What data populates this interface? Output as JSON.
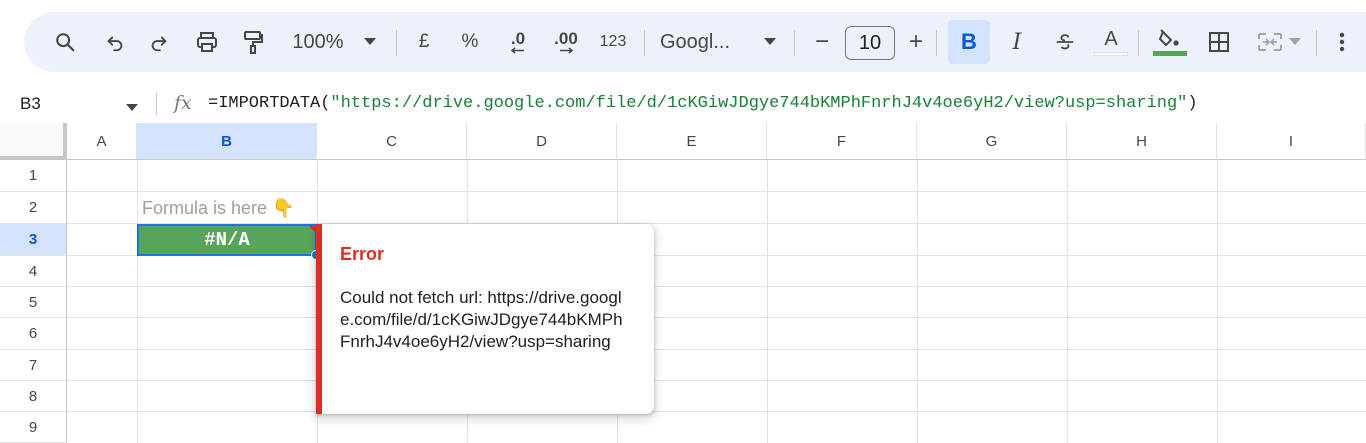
{
  "toolbar": {
    "zoom": "100%",
    "currency": "£",
    "percent": "%",
    "decrease_decimal": ".0",
    "increase_decimal": ".00",
    "number_format": "123",
    "font": "Googl...",
    "font_size": "10",
    "size_minus": "−",
    "size_plus": "+",
    "bold": "B",
    "italic": "I",
    "text_color_letter": "A",
    "colors": {
      "accent": "#d3e3fd",
      "fill_underline": "#57a55b",
      "text_underline": "#ffffff"
    },
    "icons": [
      "search-icon",
      "undo-icon",
      "redo-icon",
      "print-icon",
      "paint-format-icon",
      "chevron-down-icon",
      "strikethrough-icon",
      "fill-color-icon",
      "borders-icon",
      "merge-cells-icon",
      "more-icon"
    ]
  },
  "formula_bar": {
    "name_box": "B3",
    "fx": "fx",
    "formula_prefix": "=IMPORTDATA(",
    "formula_string": "\"https://drive.google.com/file/d/1cKGiwJDgye744bKMPhFnrhJ4v4oe6yH2/view?usp=sharing\"",
    "formula_suffix": ")"
  },
  "grid": {
    "columns": [
      "A",
      "B",
      "C",
      "D",
      "E",
      "F",
      "G",
      "H",
      "I"
    ],
    "rows": [
      "1",
      "2",
      "3",
      "4",
      "5",
      "6",
      "7",
      "8",
      "9"
    ],
    "selected_column": "B",
    "selected_row": "3",
    "cells": {
      "B2": "Formula is here 👇",
      "B3": "#N/A"
    },
    "colors": {
      "b3_fill": "#57a55b",
      "selection": "#1a73e8"
    }
  },
  "error_popup": {
    "title": "Error",
    "body": "Could not fetch url: https://drive.google.com/file/d/1cKGiwJDgye744bKMPhFnrhJ4v4oe6yH2/view?usp=sharing",
    "colors": {
      "accent": "#d93025"
    }
  }
}
